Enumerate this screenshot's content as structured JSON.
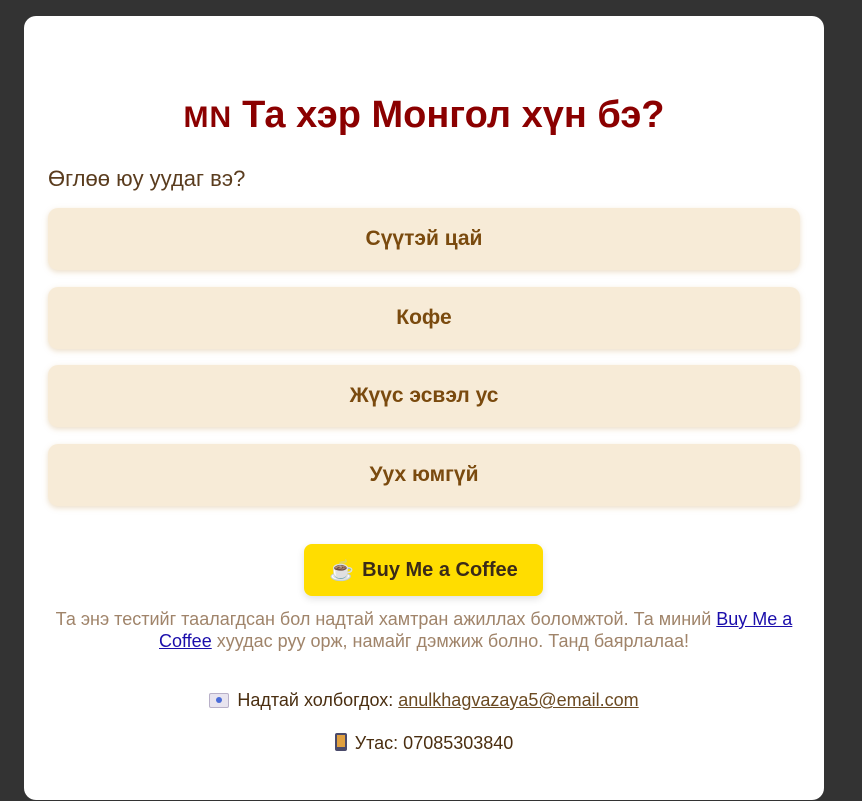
{
  "header": {
    "flag_text": "MN",
    "title": "Та хэр Монгол хүн бэ?"
  },
  "question": "Өглөө юу уудаг вэ?",
  "options": [
    {
      "label": "Сүүтэй цай"
    },
    {
      "label": "Кофе"
    },
    {
      "label": "Жүүс эсвэл ус"
    },
    {
      "label": "Уух юмгүй"
    }
  ],
  "bmc_button": {
    "icon": "coffee-cup-icon",
    "label": "Buy Me a Coffee"
  },
  "support": {
    "text_before": "Та энэ тестийг таалагдсан бол надтай хамтран ажиллах боломжтой. Та миний ",
    "link_text": "Buy Me a Coffee",
    "text_after": " хуудас руу орж, намайг дэмжиж болно. Танд баярлалаа!"
  },
  "contact": {
    "email_label": "Надтай холбогдох: ",
    "email": "anulkhagvazaya5@email.com",
    "phone_text": "Утас: 07085303840"
  },
  "colors": {
    "background": "#333333",
    "card": "#ffffff",
    "title": "#8b0000",
    "option_bg": "#f7ebd7",
    "option_text": "#7a4a0e",
    "bmc_bg": "#ffdd00"
  }
}
